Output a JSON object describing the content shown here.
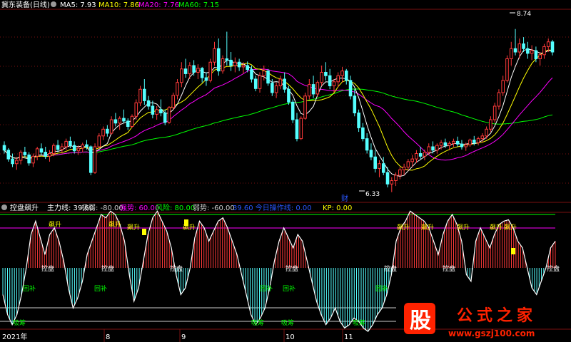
{
  "main_title": "冀东装备(日线)",
  "main_legend": [
    {
      "label": "MA5: 7.93",
      "color": "#ffffff"
    },
    {
      "label": "MA10: 7.86",
      "color": "#ffff00"
    },
    {
      "label": "MA20: 7.76",
      "color": "#ff00ff"
    },
    {
      "label": "MA60: 7.15",
      "color": "#00ff00"
    }
  ],
  "annotations": {
    "high": "8.74",
    "low": "6.33",
    "cai": "财"
  },
  "indicator": {
    "name": "控盘飙升",
    "legend": [
      {
        "label": "主力线: 39.60",
        "color": "#ffffff"
      },
      {
        "label": "极弱: -80.00",
        "color": "#cccccc"
      },
      {
        "label": "强势: 60.00",
        "color": "#ff00ff"
      },
      {
        "label": "风险: 80.00",
        "color": "#00ff00"
      },
      {
        "label": "弱势: -60.00",
        "color": "#cccccc"
      },
      {
        "label": "39.60  今日操作线: 0.00",
        "color": "#2a57ff"
      },
      {
        "label": "KP: 0.00",
        "color": "#ffff00"
      }
    ],
    "signals": {
      "feng_sheng": "飙升",
      "kong_pan": "控盘",
      "hui_bu": "回补",
      "xi_chou": "吸筹"
    }
  },
  "xaxis": {
    "year": "2021年",
    "months": [
      "8",
      "9",
      "10",
      "11"
    ]
  },
  "watermark": {
    "icon_text": "股",
    "title": "公式之家",
    "url": "www.gszj100.com"
  },
  "colors": {
    "bg": "#000000",
    "up": "#ff3a3a",
    "down": "#54ffff",
    "ma5": "#ffffff",
    "ma10": "#ffff00",
    "ma20": "#ff00ff",
    "ma60": "#00ff00",
    "grid": "#7a1010",
    "ref_line": "#cccccc",
    "watermark": "#ff2200"
  },
  "chart_data": [
    {
      "type": "candlestick",
      "title": "冀东装备(日线)",
      "y_range": [
        6.2,
        9.0
      ],
      "high_label": 8.74,
      "low_label": 6.33,
      "ohlc": [
        [
          7.02,
          7.08,
          6.9,
          6.95
        ],
        [
          6.95,
          6.98,
          6.78,
          6.82
        ],
        [
          6.82,
          6.9,
          6.7,
          6.75
        ],
        [
          6.75,
          6.85,
          6.66,
          6.8
        ],
        [
          6.8,
          6.95,
          6.74,
          6.92
        ],
        [
          6.92,
          7.0,
          6.85,
          6.88
        ],
        [
          6.88,
          6.92,
          6.72,
          6.76
        ],
        [
          6.76,
          6.9,
          6.7,
          6.86
        ],
        [
          6.86,
          7.0,
          6.8,
          6.97
        ],
        [
          6.97,
          7.05,
          6.88,
          6.92
        ],
        [
          6.92,
          7.0,
          6.82,
          6.86
        ],
        [
          6.86,
          6.95,
          6.78,
          6.9
        ],
        [
          6.9,
          7.05,
          6.86,
          7.02
        ],
        [
          7.02,
          7.1,
          6.92,
          6.96
        ],
        [
          6.96,
          7.05,
          6.9,
          7.0
        ],
        [
          7.0,
          7.12,
          6.95,
          7.08
        ],
        [
          7.08,
          7.15,
          6.98,
          7.02
        ],
        [
          7.02,
          7.08,
          6.9,
          6.94
        ],
        [
          6.94,
          7.02,
          6.88,
          6.98
        ],
        [
          6.98,
          7.06,
          6.92,
          7.03
        ],
        [
          7.03,
          7.1,
          6.96,
          7.0
        ],
        [
          7.0,
          7.02,
          6.58,
          6.62
        ],
        [
          6.62,
          7.05,
          6.6,
          7.0
        ],
        [
          7.0,
          7.2,
          6.98,
          7.16
        ],
        [
          7.16,
          7.3,
          7.1,
          7.26
        ],
        [
          7.26,
          7.32,
          7.15,
          7.2
        ],
        [
          7.2,
          7.45,
          7.18,
          7.4
        ],
        [
          7.4,
          7.5,
          7.3,
          7.35
        ],
        [
          7.35,
          7.45,
          7.25,
          7.42
        ],
        [
          7.42,
          7.55,
          7.35,
          7.38
        ],
        [
          7.38,
          7.42,
          7.25,
          7.3
        ],
        [
          7.3,
          7.48,
          7.28,
          7.45
        ],
        [
          7.45,
          7.7,
          7.4,
          7.65
        ],
        [
          7.65,
          7.9,
          7.6,
          7.85
        ],
        [
          7.85,
          8.0,
          7.62,
          7.68
        ],
        [
          7.68,
          7.75,
          7.55,
          7.6
        ],
        [
          7.6,
          7.68,
          7.42,
          7.48
        ],
        [
          7.48,
          7.6,
          7.4,
          7.55
        ],
        [
          7.55,
          7.7,
          7.45,
          7.5
        ],
        [
          7.5,
          7.55,
          7.32,
          7.36
        ],
        [
          7.36,
          7.6,
          7.34,
          7.58
        ],
        [
          7.58,
          7.8,
          7.55,
          7.76
        ],
        [
          7.76,
          8.0,
          7.7,
          7.95
        ],
        [
          7.95,
          8.25,
          7.88,
          8.15
        ],
        [
          8.15,
          8.3,
          8.02,
          8.08
        ],
        [
          8.08,
          8.25,
          8.0,
          8.2
        ],
        [
          8.2,
          8.28,
          8.05,
          8.1
        ],
        [
          8.1,
          8.22,
          8.0,
          8.16
        ],
        [
          8.16,
          8.18,
          7.95,
          8.02
        ],
        [
          8.02,
          8.1,
          7.9,
          7.98
        ],
        [
          7.98,
          8.3,
          7.95,
          8.25
        ],
        [
          8.25,
          8.55,
          8.2,
          8.45
        ],
        [
          8.45,
          8.6,
          8.05,
          8.12
        ],
        [
          8.12,
          8.35,
          8.08,
          8.3
        ],
        [
          8.3,
          8.7,
          8.2,
          8.28
        ],
        [
          8.28,
          8.4,
          8.12,
          8.2
        ],
        [
          8.2,
          8.32,
          8.1,
          8.25
        ],
        [
          8.25,
          8.3,
          8.12,
          8.18
        ],
        [
          8.18,
          8.25,
          8.08,
          8.2
        ],
        [
          8.2,
          8.26,
          8.1,
          8.14
        ],
        [
          8.14,
          8.2,
          7.95,
          8.0
        ],
        [
          8.0,
          8.05,
          7.82,
          7.86
        ],
        [
          7.86,
          8.1,
          7.8,
          8.05
        ],
        [
          8.05,
          8.2,
          7.98,
          8.12
        ],
        [
          8.12,
          8.15,
          7.9,
          7.94
        ],
        [
          7.94,
          8.0,
          7.75,
          7.8
        ],
        [
          7.8,
          7.95,
          7.72,
          7.9
        ],
        [
          7.9,
          8.05,
          7.85,
          8.0
        ],
        [
          8.0,
          8.1,
          7.8,
          7.85
        ],
        [
          7.85,
          7.9,
          7.62,
          7.66
        ],
        [
          7.66,
          7.7,
          7.35,
          7.4
        ],
        [
          7.4,
          7.5,
          7.08,
          7.12
        ],
        [
          7.12,
          7.45,
          7.1,
          7.42
        ],
        [
          7.42,
          7.8,
          7.4,
          7.75
        ],
        [
          7.75,
          8.0,
          7.7,
          7.92
        ],
        [
          7.92,
          8.05,
          7.72,
          7.78
        ],
        [
          7.78,
          7.98,
          7.74,
          7.95
        ],
        [
          7.95,
          8.2,
          7.9,
          8.1
        ],
        [
          8.1,
          8.25,
          7.98,
          8.05
        ],
        [
          8.05,
          8.15,
          7.85,
          7.9
        ],
        [
          7.9,
          8.0,
          7.8,
          7.96
        ],
        [
          7.96,
          8.1,
          7.88,
          8.05
        ],
        [
          8.05,
          8.18,
          7.95,
          8.12
        ],
        [
          8.12,
          8.15,
          7.92,
          7.98
        ],
        [
          7.98,
          8.05,
          7.7,
          7.75
        ],
        [
          7.75,
          7.85,
          7.45,
          7.5
        ],
        [
          7.5,
          7.55,
          7.22,
          7.28
        ],
        [
          7.28,
          7.35,
          7.08,
          7.12
        ],
        [
          7.12,
          7.2,
          6.9,
          6.95
        ],
        [
          6.95,
          7.05,
          6.8,
          6.85
        ],
        [
          6.85,
          6.95,
          6.62,
          6.68
        ],
        [
          6.68,
          6.8,
          6.55,
          6.75
        ],
        [
          6.75,
          6.85,
          6.58,
          6.62
        ],
        [
          6.62,
          6.7,
          6.4,
          6.45
        ],
        [
          6.45,
          6.55,
          6.33,
          6.5
        ],
        [
          6.5,
          6.62,
          6.42,
          6.58
        ],
        [
          6.58,
          6.7,
          6.52,
          6.66
        ],
        [
          6.66,
          6.75,
          6.58,
          6.7
        ],
        [
          6.7,
          6.82,
          6.65,
          6.78
        ],
        [
          6.78,
          6.88,
          6.7,
          6.82
        ],
        [
          6.82,
          6.95,
          6.76,
          6.9
        ],
        [
          6.9,
          7.0,
          6.82,
          6.86
        ],
        [
          6.86,
          6.96,
          6.8,
          6.92
        ],
        [
          6.92,
          7.05,
          6.88,
          7.0
        ],
        [
          7.0,
          7.08,
          6.9,
          6.95
        ],
        [
          6.95,
          7.05,
          6.9,
          7.02
        ],
        [
          7.02,
          7.1,
          6.96,
          7.06
        ],
        [
          7.06,
          7.12,
          6.98,
          7.02
        ],
        [
          7.02,
          7.08,
          6.95,
          7.05
        ],
        [
          7.05,
          7.12,
          7.0,
          7.08
        ],
        [
          7.08,
          7.15,
          7.0,
          7.04
        ],
        [
          7.04,
          7.1,
          6.96,
          7.0
        ],
        [
          7.0,
          7.06,
          6.94,
          7.03
        ],
        [
          7.03,
          7.12,
          7.0,
          7.1
        ],
        [
          7.1,
          7.16,
          7.02,
          7.06
        ],
        [
          7.06,
          7.15,
          7.02,
          7.12
        ],
        [
          7.12,
          7.2,
          7.06,
          7.16
        ],
        [
          7.16,
          7.3,
          7.12,
          7.26
        ],
        [
          7.26,
          7.45,
          7.22,
          7.4
        ],
        [
          7.4,
          7.65,
          7.36,
          7.6
        ],
        [
          7.6,
          7.85,
          7.55,
          7.8
        ],
        [
          7.8,
          8.05,
          7.75,
          7.98
        ],
        [
          7.98,
          8.35,
          7.95,
          8.3
        ],
        [
          8.3,
          8.55,
          8.2,
          8.45
        ],
        [
          8.45,
          8.74,
          8.35,
          8.4
        ],
        [
          8.4,
          8.6,
          8.3,
          8.52
        ],
        [
          8.52,
          8.62,
          8.4,
          8.45
        ],
        [
          8.45,
          8.55,
          8.3,
          8.38
        ],
        [
          8.38,
          8.5,
          8.28,
          8.42
        ],
        [
          8.42,
          8.48,
          8.25,
          8.3
        ],
        [
          8.3,
          8.4,
          8.2,
          8.36
        ],
        [
          8.36,
          8.52,
          8.3,
          8.48
        ],
        [
          8.48,
          8.6,
          8.4,
          8.55
        ],
        [
          8.55,
          8.58,
          8.35,
          8.4
        ]
      ]
    },
    {
      "type": "bar",
      "title": "控盘飙升",
      "y_range": [
        -100,
        100
      ],
      "reference_lines": {
        "风险": 80,
        "强势": 60,
        "弱势": -60,
        "极弱": -80
      },
      "values": [
        -40,
        -70,
        -85,
        -70,
        -40,
        0,
        50,
        70,
        45,
        20,
        50,
        60,
        40,
        10,
        -30,
        -60,
        -45,
        -20,
        20,
        40,
        60,
        80,
        75,
        85,
        80,
        65,
        40,
        -10,
        -50,
        -30,
        10,
        50,
        75,
        85,
        70,
        55,
        30,
        -10,
        -40,
        -30,
        0,
        45,
        70,
        60,
        40,
        55,
        70,
        75,
        60,
        40,
        20,
        -10,
        -40,
        -70,
        -85,
        -75,
        -60,
        -30,
        10,
        40,
        60,
        45,
        30,
        50,
        40,
        10,
        -20,
        -50,
        -70,
        -85,
        -75,
        -60,
        -80,
        -90,
        -85,
        -75,
        -80,
        -90,
        -95,
        -85,
        -70,
        -60,
        -40,
        -10,
        40,
        60,
        70,
        85,
        80,
        75,
        70,
        60,
        40,
        20,
        50,
        70,
        80,
        65,
        40,
        -10,
        -20,
        40,
        60,
        45,
        30,
        50,
        65,
        70,
        72,
        60,
        40,
        30,
        0,
        -30,
        -40,
        -20,
        0,
        30,
        40
      ],
      "last_value": 39.6,
      "operation_line": 0.0,
      "kp": 0.0
    }
  ]
}
